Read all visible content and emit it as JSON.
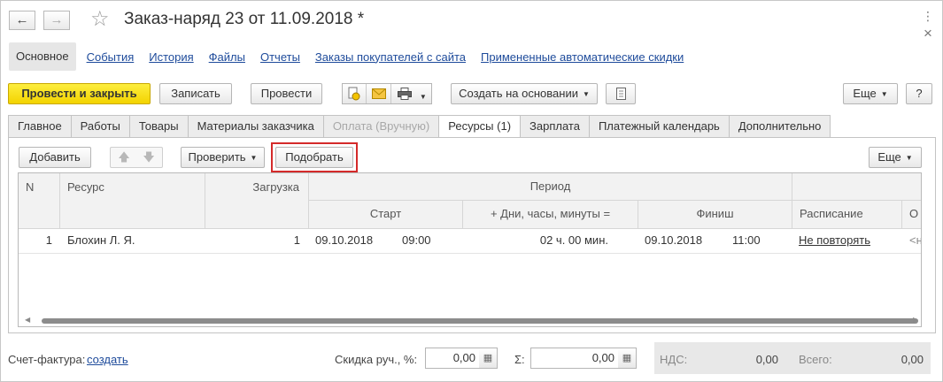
{
  "window": {
    "title": "Заказ-наряд 23 от 11.09.2018 *",
    "back_icon": "←",
    "forward_icon": "→",
    "star_icon": "☆",
    "more_icon": "⋮",
    "close_icon": "×"
  },
  "nav_links": {
    "main": "Основное",
    "events": "События",
    "history": "История",
    "files": "Файлы",
    "reports": "Отчеты",
    "site_orders": "Заказы покупателей с сайта",
    "discounts": "Примененные автоматические скидки"
  },
  "toolbar": {
    "post_close": "Провести и закрыть",
    "save": "Записать",
    "post": "Провести",
    "create_based": "Создать на основании",
    "more": "Еще",
    "help": "?"
  },
  "tabs": [
    "Главное",
    "Работы",
    "Товары",
    "Материалы заказчика",
    "Оплата (Вручную)",
    "Ресурсы (1)",
    "Зарплата",
    "Платежный календарь",
    "Дополнительно"
  ],
  "active_tab": "Ресурсы (1)",
  "resources": {
    "add": "Добавить",
    "check": "Проверить",
    "pick": "Подобрать",
    "more": "Еще",
    "columns": {
      "n": "N",
      "resource": "Ресурс",
      "load": "Загрузка",
      "period": "Период",
      "start": "Старт",
      "duration": "+ Дни, часы, минуты =",
      "finish": "Финиш",
      "schedule": "Расписание",
      "extra": "О"
    },
    "rows": [
      {
        "n": "1",
        "resource": "Блохин Л. Я.",
        "load": "1",
        "start_date": "09.10.2018",
        "start_time": "09:00",
        "duration": "02 ч. 00 мин.",
        "finish_date": "09.10.2018",
        "finish_time": "11:00",
        "schedule": "Не повторять",
        "extra": "<н"
      }
    ]
  },
  "footer": {
    "invoice_label": "Счет-фактура:",
    "invoice_link": "создать",
    "discount_label": "Скидка руч., %:",
    "discount_value": "0,00",
    "sum_label": "Σ:",
    "sum_value": "0,00",
    "vat_label": "НДС:",
    "vat_value": "0,00",
    "total_label": "Всего:",
    "total_value": "0,00"
  },
  "colors": {
    "primary_button": "#f3d300",
    "link": "#1e4b9b",
    "highlight_border": "#d42a2a"
  }
}
